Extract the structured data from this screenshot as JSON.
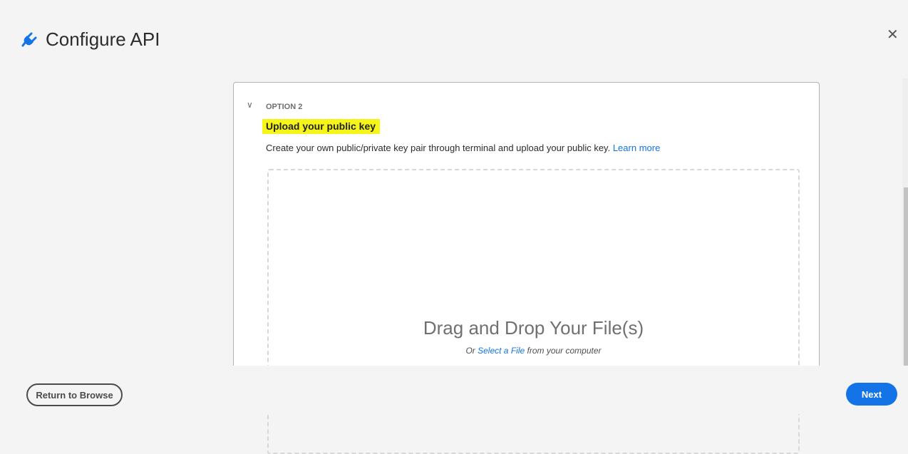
{
  "header": {
    "title": "Configure API",
    "icon": "plug-icon",
    "close_icon": "close-icon"
  },
  "option": {
    "label": "OPTION 2",
    "heading": "Upload your public key",
    "description": "Create your own public/private key pair through terminal and upload your public key.",
    "learn_more": "Learn more"
  },
  "dropzone": {
    "title": "Drag and Drop Your File(s)",
    "prefix": "Or",
    "link": "Select a File",
    "suffix": "from your computer"
  },
  "footer": {
    "return_label": "Return to Browse",
    "next_label": "Next"
  },
  "colors": {
    "accent": "#1473e6",
    "highlight": "#f5f51a"
  }
}
